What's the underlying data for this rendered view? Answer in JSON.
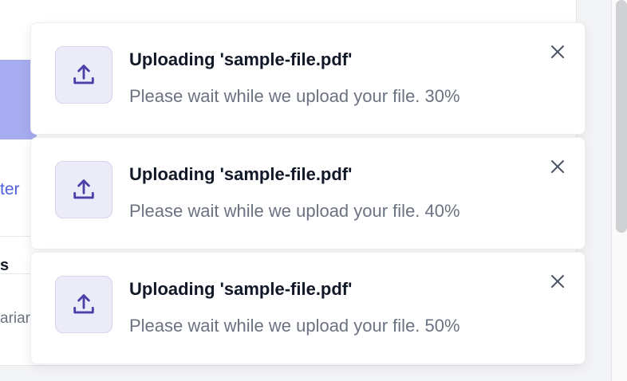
{
  "background": {
    "link_text": "ter",
    "row_heading": "s",
    "row_sub": "ariar"
  },
  "icons": {
    "upload": "upload-icon",
    "close": "close-icon"
  },
  "colors": {
    "icon_bg": "#ecebf8",
    "icon_stroke": "#4b3fa8",
    "accent_block": "#a6acef",
    "link": "#4f5fdd"
  },
  "toasts": [
    {
      "title": "Uploading 'sample-file.pdf'",
      "message": "Please wait while we upload your file. 30%",
      "progress": 30
    },
    {
      "title": "Uploading 'sample-file.pdf'",
      "message": "Please wait while we upload your file. 40%",
      "progress": 40
    },
    {
      "title": "Uploading 'sample-file.pdf'",
      "message": "Please wait while we upload your file. 50%",
      "progress": 50
    }
  ]
}
